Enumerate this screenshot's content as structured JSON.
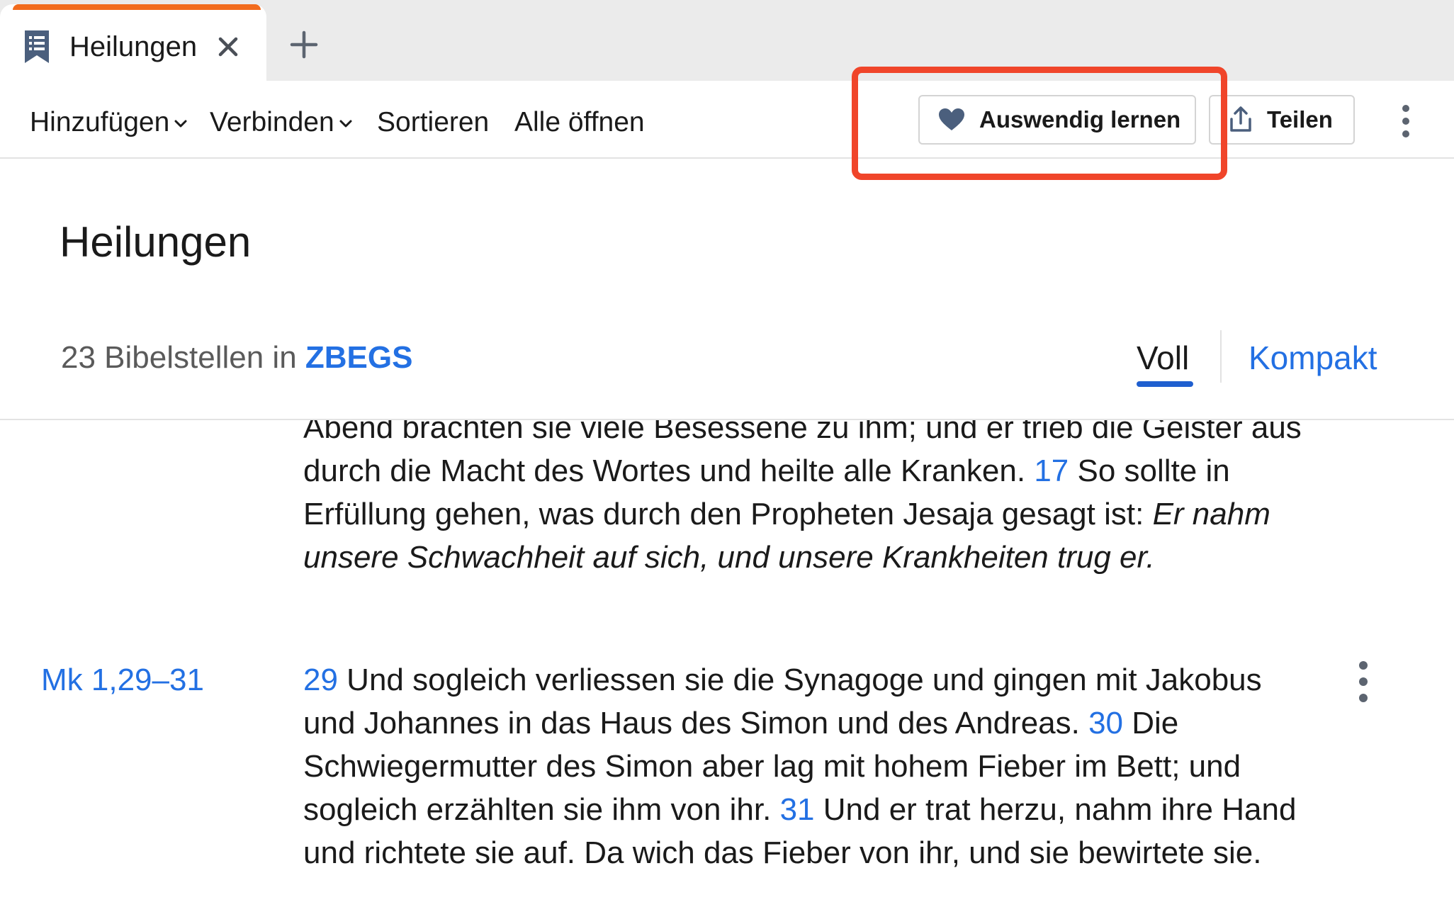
{
  "tab": {
    "title": "Heilungen",
    "icon": "bookmark-list-icon",
    "accent_color": "#f26b1d"
  },
  "toolbar": {
    "add_label": "Hinzufügen",
    "connect_label": "Verbinden",
    "sort_label": "Sortieren",
    "open_all_label": "Alle öffnen",
    "memorize_label": "Auswendig lernen",
    "share_label": "Teilen"
  },
  "header": {
    "title": "Heilungen",
    "count_text": "23 Bibelstellen in",
    "translation": "ZBEGS",
    "view_full": "Voll",
    "view_compact": "Kompakt"
  },
  "passages": [
    {
      "reference": "",
      "segments": [
        {
          "t": "Abend brachten sie viele Besessene zu ihm; und er trieb die Geister aus durch die Macht des Wortes und heilte alle Kranken. "
        },
        {
          "n": "17"
        },
        {
          "t": " So sollte in Erfüllung gehen, was durch den Propheten Jesaja gesagt ist: "
        },
        {
          "i": "Er nahm unsere Schwachheit auf sich, und unsere Krankheiten trug er."
        }
      ]
    },
    {
      "reference": "Mk 1,29–31",
      "segments": [
        {
          "n": "29"
        },
        {
          "t": " Und sogleich verliessen sie die Synagoge und gingen mit Jakobus und Johannes in das Haus des Simon und des Andreas. "
        },
        {
          "n": "30"
        },
        {
          "t": " Die Schwiegermutter des Simon aber lag mit hohem Fieber im Bett; und sogleich erzählten sie ihm von ihr. "
        },
        {
          "n": "31"
        },
        {
          "t": " Und er trat herzu, nahm ihre Hand und richtete sie auf. Da wich das Fieber von ihr, und sie bewirtete sie."
        }
      ]
    }
  ],
  "colors": {
    "link": "#2370e3",
    "highlight": "#f0452a",
    "underline": "#1f5fcf"
  }
}
